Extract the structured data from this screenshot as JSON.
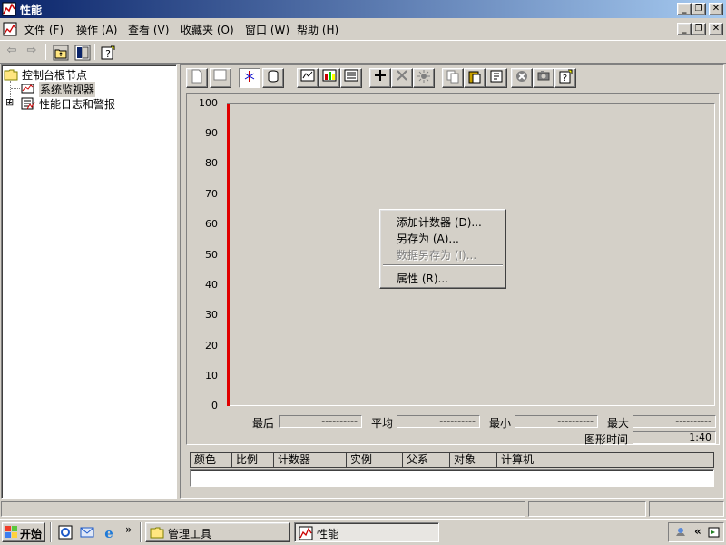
{
  "window": {
    "title": "性能",
    "min": "_",
    "restore": "❐",
    "close": "✕"
  },
  "menu": {
    "items": [
      "文件 (F)",
      "操作 (A)",
      "查看 (V)",
      "收藏夹 (O)",
      "窗口 (W)",
      "帮助 (H)"
    ]
  },
  "tree": {
    "root": "控制台根节点",
    "item1": "系统监视器",
    "item2": "性能日志和警报",
    "expander": "⊞"
  },
  "graph": {
    "yticks": [
      "100",
      "90",
      "80",
      "70",
      "60",
      "50",
      "40",
      "30",
      "20",
      "10",
      "0"
    ],
    "line_color": "#e00000"
  },
  "stats": {
    "last_label": "最后",
    "avg_label": "平均",
    "min_label": "最小",
    "max_label": "最大",
    "last_value": "----------",
    "avg_value": "----------",
    "min_value": "----------",
    "max_value": "----------",
    "duration_label": "图形时间",
    "duration_value": "1:40"
  },
  "legend": {
    "columns": [
      "颜色",
      "比例",
      "计数器",
      "实例",
      "父系",
      "对象",
      "计算机"
    ]
  },
  "context_menu": {
    "add_counters": "添加计数器 (D)...",
    "save_as": "另存为 (A)...",
    "save_data_as": "数据另存为 (I)...",
    "properties": "属性 (R)..."
  },
  "taskbar": {
    "start": "开始",
    "chevron": "»",
    "task1": "管理工具",
    "task2": "性能",
    "tray_chevron": "«"
  }
}
